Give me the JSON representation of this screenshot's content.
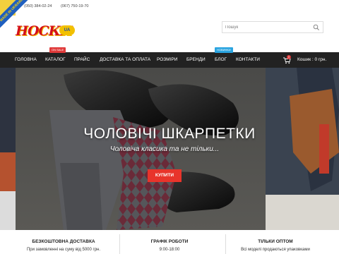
{
  "topbar": {
    "phone_1": "(050) 384-02-24",
    "phone_2": "(067) 750-19-70",
    "ribbon": "MADE IN UKRAINE"
  },
  "logo": {
    "word": "НОСКИ",
    "badge": "UA"
  },
  "search": {
    "placeholder": "Пошук",
    "icon": "search-icon"
  },
  "nav": {
    "items": [
      {
        "label": "ГОЛОВНА"
      },
      {
        "label": "КАТАЛОГ",
        "badge": "ON SALE"
      },
      {
        "label": "ПРАЙС"
      },
      {
        "label": "ДОСТАВКА ТА ОПЛАТА"
      },
      {
        "label": "РОЗМІРИ"
      },
      {
        "label": "БРЕНДИ"
      },
      {
        "label": "БЛОГ",
        "badge": "НОВИНКИ"
      },
      {
        "label": "КОНТАКТИ"
      }
    ],
    "cart": {
      "count": "0",
      "label": "Кошик : 0 грн.",
      "icon": "cart-icon"
    }
  },
  "hero": {
    "title": "ЧОЛОВІЧІ ШКАРПЕТКИ",
    "subtitle": "Чоловіча класика та не тільки...",
    "button": "КУПИТИ"
  },
  "features": [
    {
      "heading": "БЕЗКОШТОВНА ДОСТАВКА",
      "text": "При замовленні на суму від 5000 грн."
    },
    {
      "heading": "ГРАФІК РОБОТИ",
      "text": "9:00-18:00"
    },
    {
      "heading": "ТІЛЬКИ ОПТОМ",
      "text": "Всі моделі продаються упаковками"
    }
  ],
  "colors": {
    "nav_bg": "#222222",
    "accent_red": "#e8342b",
    "badge_blue": "#2aa4e0"
  }
}
